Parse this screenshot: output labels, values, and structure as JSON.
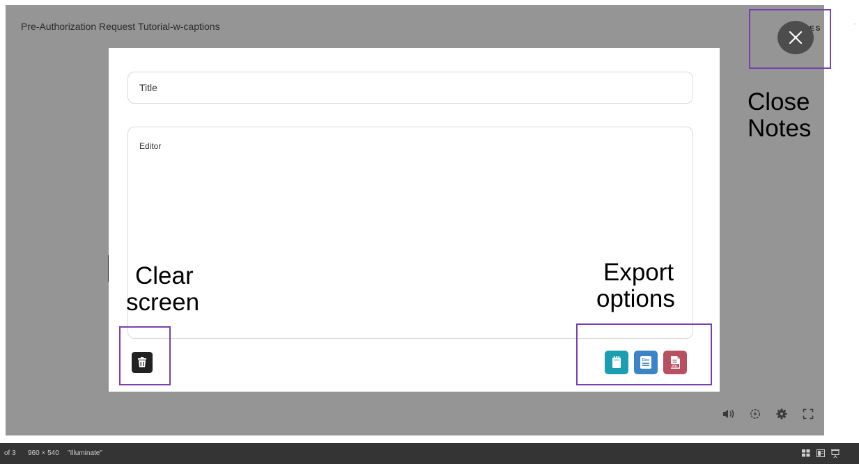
{
  "player": {
    "video_title": "Pre-Authorization Request Tutorial-w-captions",
    "notes_label": "NOTES",
    "close_icon": "close-x-icon"
  },
  "notes_modal": {
    "title_placeholder": "Title",
    "editor_placeholder": "Editor",
    "clear_icon": "trash-icon",
    "export_buttons": [
      {
        "icon": "txt-file-icon",
        "color": "#1b9eb2"
      },
      {
        "icon": "doc-file-icon",
        "color": "#3b84c6",
        "text": "Doc"
      },
      {
        "icon": "pdf-file-icon",
        "color": "#b8505f",
        "text": "PDF"
      }
    ]
  },
  "annotations": {
    "close": "Close\nNotes",
    "clear": "Clear\nscreen",
    "export": "Export\noptions",
    "highlight_color": "#7a3fb0"
  },
  "player_controls": [
    "volume-icon",
    "speed-icon",
    "settings-gear-icon",
    "fullscreen-icon"
  ],
  "statusbar": {
    "slide_info": "of 3",
    "dimensions": "960 × 540",
    "theme": "\"Illuminate\"",
    "right_icons": [
      "normal-view-icon",
      "reading-view-icon",
      "slideshow-icon"
    ]
  }
}
